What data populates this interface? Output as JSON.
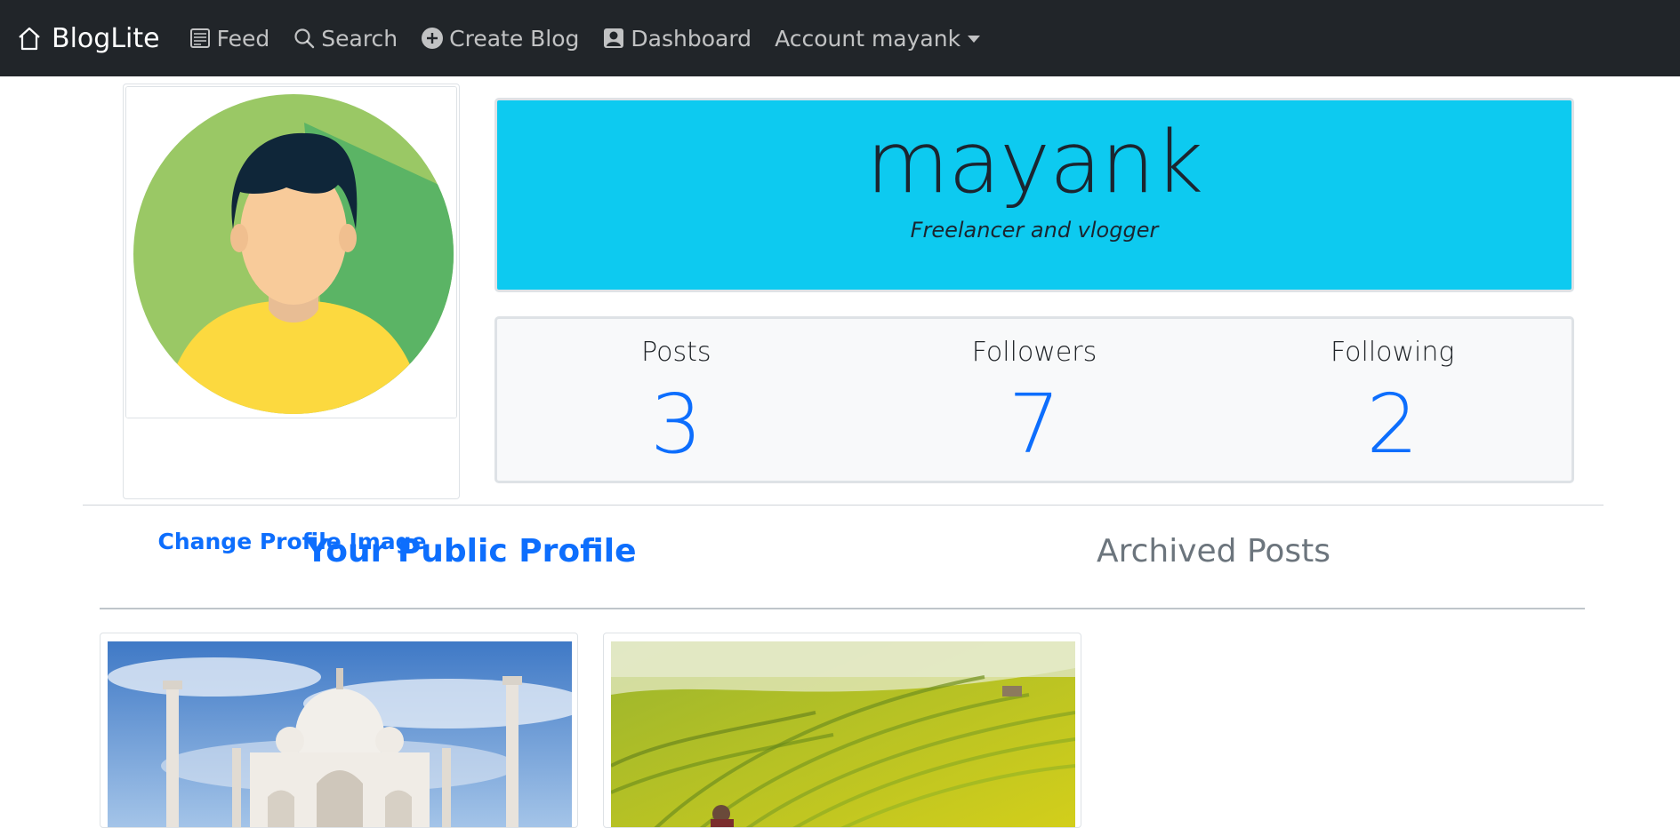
{
  "navbar": {
    "brand": "BlogLite",
    "items": [
      {
        "label": "Feed",
        "icon": "feed-icon"
      },
      {
        "label": "Search",
        "icon": "search-icon"
      },
      {
        "label": "Create Blog",
        "icon": "plus-circle-icon"
      },
      {
        "label": "Dashboard",
        "icon": "person-badge-icon"
      }
    ],
    "account_label": "Account mayank"
  },
  "profile": {
    "username": "mayank",
    "bio": "Freelancer and vlogger",
    "change_image_label": "Change Profile Image"
  },
  "stats": [
    {
      "label": "Posts",
      "value": "3"
    },
    {
      "label": "Followers",
      "value": "7"
    },
    {
      "label": "Following",
      "value": "2"
    }
  ],
  "tabs": [
    {
      "label": "Your Public Profile",
      "active": true
    },
    {
      "label": "Archived Posts",
      "active": false
    }
  ],
  "posts": [
    {
      "image": "taj-mahal-photo"
    },
    {
      "image": "rice-terraces-photo"
    }
  ],
  "colors": {
    "navbar": "#212529",
    "banner": "#0dcaf0",
    "primary": "#0d6efd",
    "muted": "#6c757d"
  }
}
